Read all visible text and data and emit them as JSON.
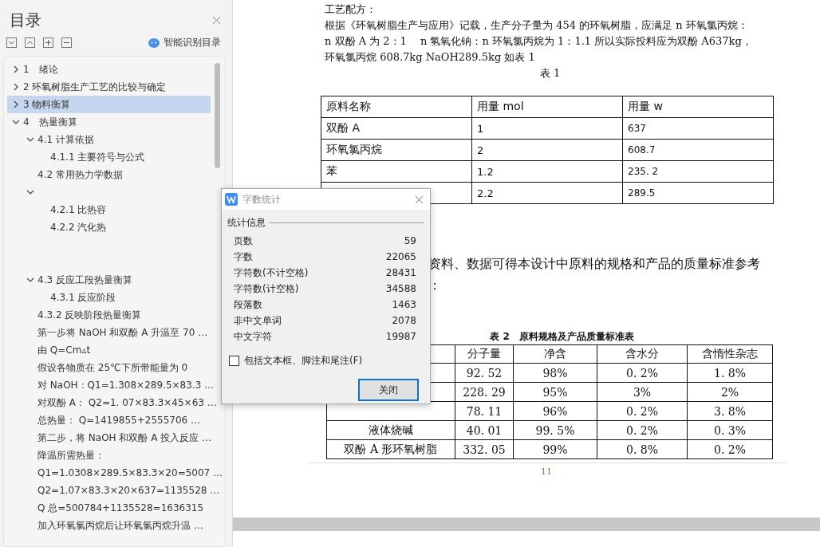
{
  "sidebar": {
    "title": "目录",
    "smart_button": "智能识别目录",
    "tree": [
      {
        "label": "1　绪论",
        "expanded": false,
        "selected": false
      },
      {
        "label": "2 环氧树脂生产工艺的比较与确定",
        "expanded": false,
        "selected": false
      },
      {
        "label": "3 物料衡算",
        "expanded": false,
        "selected": true
      },
      {
        "label": "4　热量衡算",
        "expanded": true,
        "selected": false,
        "children": [
          {
            "label": "4.1 计算依据",
            "expanded": true,
            "selected": false,
            "children": [
              {
                "label": "4.1.1  主要符号与公式",
                "selected": false
              }
            ]
          },
          {
            "label": "4.2  常用热力学数据",
            "selected": false
          },
          {
            "expanded": true,
            "selected": false,
            "children": [
              {
                "label": "4.2.1  比热容",
                "selected": false
              },
              {
                "label": "4.2.2  汽化热",
                "selected": false
              }
            ]
          },
          {
            "label": "4.3  反应工段热量衡算",
            "expanded": true,
            "selected": false,
            "children": [
              {
                "label": "4.3.1 反应阶段",
                "selected": false
              }
            ]
          },
          {
            "label": "4.3.2 反映阶段热量衡算",
            "selected": false
          },
          {
            "label": "第一步将 NaOH 和双酚 A 升温至 70 …",
            "selected": false
          },
          {
            "label": "由 Q=Cm▵t",
            "selected": false
          },
          {
            "label": "假设各物质在 25℃下所带能量为 0",
            "selected": false
          },
          {
            "label": "对 NaOH：Q1=1.308×289.5×83.3 …",
            "selected": false
          },
          {
            "label": "对双酚 A：  Q2=1. 07×83.3×45×63 …",
            "selected": false
          },
          {
            "label": "总热量：     Q=1419855+2555706 …",
            "selected": false
          },
          {
            "label": "第二步，将 NaOH 和双酚 A 投入反应 …",
            "selected": false
          },
          {
            "label": "降温所需热量：",
            "selected": false
          },
          {
            "label": "Q1=1.0308×289.5×83.3×20=5007 …",
            "selected": false
          },
          {
            "label": "Q2=1.07×83.3×20×637=1135528 …",
            "selected": false
          },
          {
            "label": "Q 总=500784+1135528=1636315",
            "selected": false
          },
          {
            "label": "加入环氧氯丙烷后让环氧氯丙烷升温 …",
            "selected": false
          }
        ]
      }
    ]
  },
  "document": {
    "paragraph_1": [
      "工艺配方：",
      "根据《环氧树脂生产与应用》记载，生产分子量为 454 的环氧树脂，应满足 n 环氧氯丙烷：",
      "n 双酚 A 为 2：1　 n 氢氧化钠：n 环氧氯丙烷为 1：1.1 所以实际投料应为双酚 A637kg，",
      "环氧氯丙烷 608.7kg NaOH289.5kg 如表 1"
    ],
    "table_1_caption": "表 1",
    "table_1": {
      "columns": [
        "原料名称",
        "用量 mol",
        "用量 w"
      ],
      "rows": [
        [
          "双酚 A",
          "1",
          "637"
        ],
        [
          "环氧氯丙烷",
          "2",
          "608.7"
        ],
        [
          "苯",
          "1.2",
          "235. 2"
        ],
        [
          "",
          "2.2",
          "289.5"
        ]
      ]
    },
    "paragraph_2": [
      "资料、数据可得本设计中原料的规格和产品的质量标准参考",
      "："
    ],
    "table_2_caption": "表 2　原料规格及产品质量标准表",
    "table_2": {
      "columns": [
        "",
        "分子量",
        "净含",
        "含水分",
        "含惰性杂志"
      ],
      "rows": [
        [
          "",
          "92. 52",
          "98%",
          "0. 2%",
          "1. 8%"
        ],
        [
          "",
          "228. 29",
          "95%",
          "3%",
          "2%"
        ],
        [
          "",
          "78. 11",
          "96%",
          "0. 2%",
          "3. 8%"
        ],
        [
          "液体烧碱",
          "40. 01",
          "99. 5%",
          "0. 2%",
          "0. 3%"
        ],
        [
          "双酚 A 形环氧树脂",
          "332. 05",
          "99%",
          "0. 8%",
          "0. 2%"
        ]
      ]
    },
    "page_number": "11"
  },
  "dialog": {
    "title": "字数统计",
    "section": "统计信息",
    "stats": [
      {
        "label": "页数",
        "value": "59"
      },
      {
        "label": "字数",
        "value": "22065"
      },
      {
        "label": "字符数(不计空格)",
        "value": "28431"
      },
      {
        "label": "字符数(计空格)",
        "value": "34588"
      },
      {
        "label": "段落数",
        "value": "1463"
      },
      {
        "label": "非中文单词",
        "value": "2078"
      },
      {
        "label": "中文字符",
        "value": "19987"
      }
    ],
    "checkbox": {
      "label": "包括文本框、脚注和尾注(F)",
      "checked": false
    },
    "button": "关闭"
  }
}
